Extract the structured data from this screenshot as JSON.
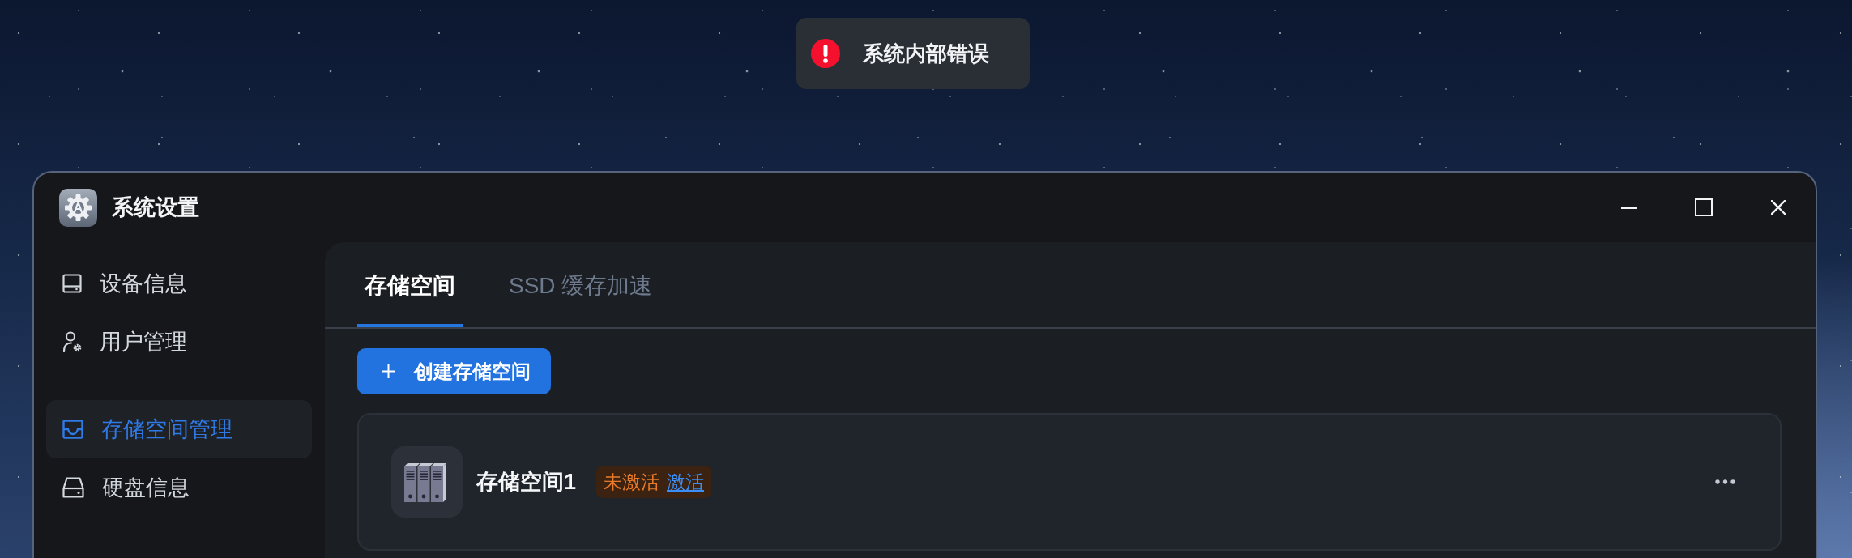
{
  "toast": {
    "kind": "error",
    "message": "系统内部错误"
  },
  "window": {
    "title": "系统设置"
  },
  "sidebar": {
    "groups": [
      {
        "items": [
          {
            "label": "设备信息",
            "selected": false
          },
          {
            "label": "用户管理",
            "selected": false
          }
        ]
      },
      {
        "items": [
          {
            "label": "存储空间管理",
            "selected": true
          },
          {
            "label": "硬盘信息",
            "selected": false
          }
        ]
      }
    ]
  },
  "tabs": [
    {
      "label": "存储空间",
      "selected": true
    },
    {
      "label": "SSD 缓存加速",
      "selected": false
    }
  ],
  "create_button": {
    "label": "创建存储空间"
  },
  "storage_spaces": [
    {
      "name": "存储空间1",
      "status": "未激活",
      "action": "激活",
      "activated": false
    }
  ]
}
